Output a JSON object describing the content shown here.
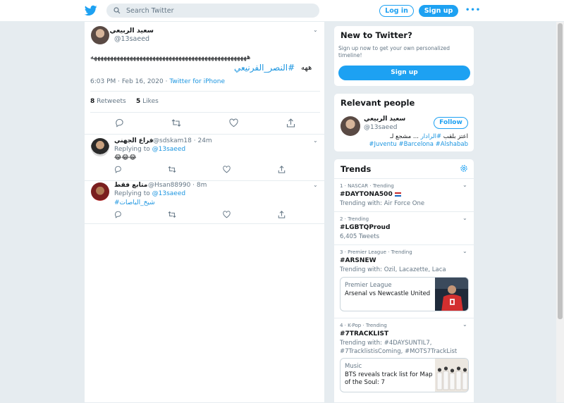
{
  "header": {
    "search_placeholder": "Search Twitter",
    "login_label": "Log in",
    "signup_label": "Sign up",
    "more_label": "•••"
  },
  "tweet": {
    "author_name": "سعيد الربيعي",
    "author_handle": "@13saeed",
    "text": "ههههههههههههههههههههههههههههههههههههههههههههههههه",
    "hashtag": "#النصر_الفرنيعي",
    "text_suffix": "ههه",
    "time": "6:03 PM · Feb 16, 2020",
    "source": "Twitter for iPhone",
    "retweets_count": "8",
    "retweets_label": "Retweets",
    "likes_count": "5",
    "likes_label": "Likes"
  },
  "replies": [
    {
      "name": "فراع الجهني",
      "handle": "@sdskam18",
      "time": "24m",
      "replying_label": "Replying to",
      "replying_to": "@13saeed",
      "body": "😂😂😂"
    },
    {
      "name": "متابع فقط",
      "handle": "@Hsan88990",
      "time": "8m",
      "replying_label": "Replying to",
      "replying_to": "@13saeed",
      "body": "#شيخ_الباصات"
    }
  ],
  "sidebar": {
    "new_to_twitter": {
      "title": "New to Twitter?",
      "text": "Sign up now to get your own personalized timeline!",
      "button": "Sign up"
    },
    "relevant": {
      "title": "Relevant people",
      "name": "سعيد الربيعي",
      "handle": "@13saeed",
      "follow": "Follow",
      "bio_text": "اعتز بلقب",
      "bio_link": "#الرادار",
      "bio_text2": "... مشجع لـ",
      "bio_tags": "#Juventu #Barcelona #Alshabab"
    },
    "trends": {
      "title": "Trends",
      "items": [
        {
          "context": "1 · NASCAR · Trending",
          "name": "#DAYTONA500",
          "sub": "Trending with: Air Force One"
        },
        {
          "context": "2 · Trending",
          "name": "#LGBTQProud",
          "sub": "6,405 Tweets"
        },
        {
          "context": "3 · Premier League · Trending",
          "name": "#ARSNEW",
          "sub": "Trending with: Ozil, Lacazette, Laca",
          "news_cat": "Premier League",
          "news_head": "Arsenal vs Newcastle United"
        },
        {
          "context": "4 · K-Pop · Trending",
          "name": "#7TRACKLIST",
          "sub": "Trending with: #4DAYSUNTIL7, #7TracklistisComing, #MOTS7TrackList",
          "news_cat": "Music",
          "news_head": "BTS reveals track list for Map of the Soul: 7"
        }
      ]
    }
  },
  "colors": {
    "brand": "#1da1f2",
    "link": "#1b95e0",
    "background": "#e6ecf0"
  }
}
